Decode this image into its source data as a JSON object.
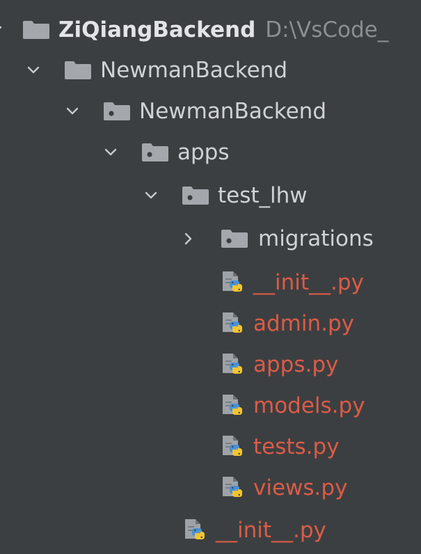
{
  "colors": {
    "background": "#3c3f41",
    "folder_icon": "#9aa0a6",
    "text": "#cfd2d6",
    "modified_file": "#dc5b47",
    "path_hint": "#8c8f92"
  },
  "tree": {
    "root": {
      "label": "ZiQiangBackend",
      "path": "D:\\VsCode_",
      "icon": "folder-icon"
    },
    "project": {
      "label": "NewmanBackend",
      "icon": "folder-icon"
    },
    "package": {
      "label": "NewmanBackend",
      "icon": "package-folder-icon"
    },
    "apps": {
      "label": "apps",
      "icon": "package-folder-icon"
    },
    "test_lhw": {
      "label": "test_lhw",
      "icon": "package-folder-icon"
    },
    "migrations": {
      "label": "migrations",
      "icon": "package-folder-icon"
    },
    "files": [
      {
        "label": "__init__.py",
        "icon": "python-file-icon"
      },
      {
        "label": "admin.py",
        "icon": "python-file-icon"
      },
      {
        "label": "apps.py",
        "icon": "python-file-icon"
      },
      {
        "label": "models.py",
        "icon": "python-file-icon"
      },
      {
        "label": "tests.py",
        "icon": "python-file-icon"
      },
      {
        "label": "views.py",
        "icon": "python-file-icon"
      }
    ],
    "package_init": {
      "label": "__init__.py",
      "icon": "python-file-icon"
    }
  }
}
